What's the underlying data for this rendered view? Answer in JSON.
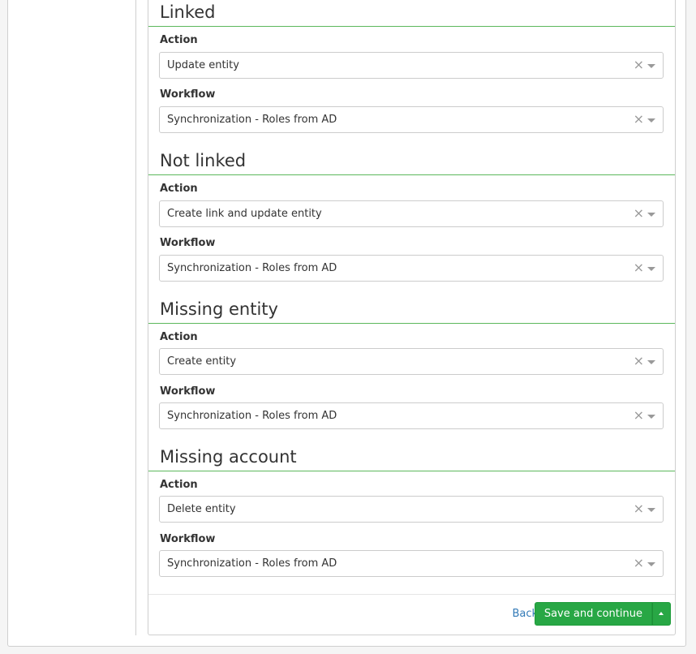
{
  "sections": [
    {
      "title": "Linked",
      "action_label": "Action",
      "action_value": "Update entity",
      "workflow_label": "Workflow",
      "workflow_value": "Synchronization - Roles from AD"
    },
    {
      "title": "Not linked",
      "action_label": "Action",
      "action_value": "Create link and update entity",
      "workflow_label": "Workflow",
      "workflow_value": "Synchronization - Roles from AD"
    },
    {
      "title": "Missing entity",
      "action_label": "Action",
      "action_value": "Create entity",
      "workflow_label": "Workflow",
      "workflow_value": "Synchronization - Roles from AD"
    },
    {
      "title": "Missing account",
      "action_label": "Action",
      "action_value": "Delete entity",
      "workflow_label": "Workflow",
      "workflow_value": "Synchronization - Roles from AD"
    }
  ],
  "select_clear_glyph": "×",
  "footer": {
    "back_label": "Back",
    "save_label": "Save and continue"
  },
  "colors": {
    "section_border": "#5cb85c",
    "primary_button": "#28a745",
    "link": "#337ab7"
  }
}
